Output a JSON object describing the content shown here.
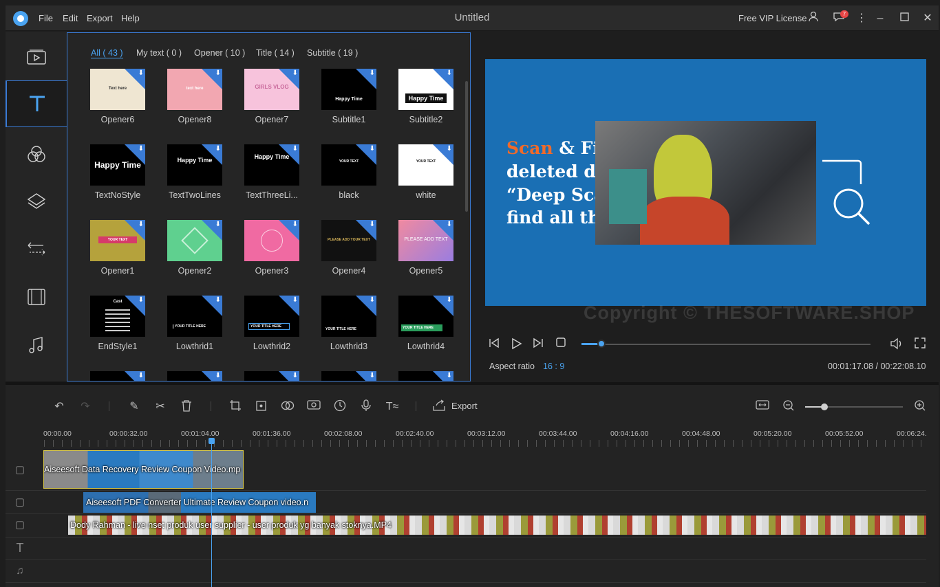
{
  "app": {
    "title": "Untitled",
    "menu": [
      "File",
      "Edit",
      "Export",
      "Help"
    ],
    "vip_label": "Free VIP License",
    "notification_count": "7"
  },
  "sidebar": {
    "items": [
      {
        "name": "media",
        "icon": "media-play-icon"
      },
      {
        "name": "text",
        "icon": "text-t-icon",
        "active": true
      },
      {
        "name": "filters",
        "icon": "filters-circles-icon"
      },
      {
        "name": "overlays",
        "icon": "layers-icon"
      },
      {
        "name": "transitions",
        "icon": "transition-arrows-icon"
      },
      {
        "name": "elements",
        "icon": "film-icon"
      },
      {
        "name": "music",
        "icon": "music-note-icon"
      }
    ]
  },
  "library": {
    "tabs": [
      "All ( 43 )",
      "My text ( 0 )",
      "Opener ( 10 )",
      "Title ( 14 )",
      "Subtitle ( 19 )"
    ],
    "items": [
      {
        "label": "Opener6",
        "thumb_text": "Text here"
      },
      {
        "label": "Opener8",
        "thumb_text": "text here"
      },
      {
        "label": "Opener7",
        "thumb_text": "GIRLS VLOG"
      },
      {
        "label": "Subtitle1",
        "thumb_text": "Happy Time"
      },
      {
        "label": "Subtitle2",
        "thumb_text": "Happy Time"
      },
      {
        "label": "TextNoStyle",
        "thumb_text": "Happy Time"
      },
      {
        "label": "TextTwoLines",
        "thumb_text": "Happy Time"
      },
      {
        "label": "TextThreeLi...",
        "thumb_text": "Happy Time"
      },
      {
        "label": "black",
        "thumb_text": "YOUR TEXT"
      },
      {
        "label": "white",
        "thumb_text": "YOUR TEXT"
      },
      {
        "label": "Opener1",
        "thumb_text": "YOUR TEXT"
      },
      {
        "label": "Opener2",
        "thumb_text": ""
      },
      {
        "label": "Opener3",
        "thumb_text": ""
      },
      {
        "label": "Opener4",
        "thumb_text": "PLEASE ADD YOUR TEXT"
      },
      {
        "label": "Opener5",
        "thumb_text": "PLEASE ADD TEXT"
      },
      {
        "label": "EndStyle1",
        "thumb_text": "Cast"
      },
      {
        "label": "Lowthrid1",
        "thumb_text": "YOUR TITLE HERE"
      },
      {
        "label": "Lowthrid2",
        "thumb_text": "YOUR TITLE HERE"
      },
      {
        "label": "Lowthrid3",
        "thumb_text": "YOUR TITLE HERE"
      },
      {
        "label": "Lowthrid4",
        "thumb_text": "YOUR TITLE HERE"
      }
    ]
  },
  "preview": {
    "text_line1a": "Scan",
    "text_line1b": "& Fir",
    "text_line2": "deleted da",
    "text_line3": "“Deep Sca",
    "text_line4": "find all th",
    "watermark": "Copyright © THESOFTWARE.SHOP",
    "aspect_label": "Aspect ratio",
    "aspect_value": "16 : 9",
    "timecode": "00:01:17.08 / 00:22:08.10",
    "progress": 0.07,
    "accent": "#4aa3f0"
  },
  "timeline": {
    "export_label": "Export",
    "zoom": 0.2,
    "ruler": [
      "00:00.00",
      "00:00:32.00",
      "00:01:04.00",
      "00:01:36.00",
      "00:02:08.00",
      "00:02:40.00",
      "00:03:12.00",
      "00:03:44.00",
      "00:04:16.00",
      "00:04:48.00",
      "00:05:20.00",
      "00:05:52.00",
      "00:06:24."
    ],
    "clips": [
      {
        "name": "Aiseesoft Data Recovery Review Coupon Video.mp"
      },
      {
        "name": "Aiseesoft PDF Converter Ultimate Review Coupon video.n"
      },
      {
        "name": "Dody Rahman - live nset produk user supplier - user produk yg banyak stoknya.MP4"
      }
    ]
  }
}
